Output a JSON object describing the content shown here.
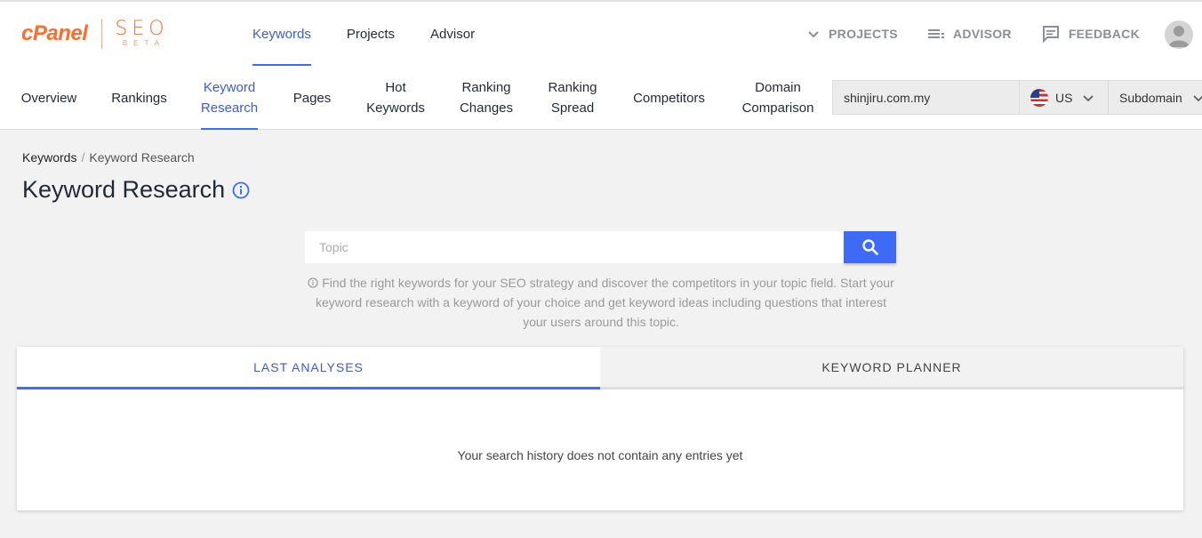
{
  "brand": {
    "name": "cPanel",
    "product": "SEO",
    "badge": "BETA",
    "accent": "#ff6c2c"
  },
  "main_nav": [
    {
      "label": "Keywords",
      "active": true
    },
    {
      "label": "Projects",
      "active": false
    },
    {
      "label": "Advisor",
      "active": false
    }
  ],
  "right_nav": {
    "projects": {
      "label": "PROJECTS",
      "icon": "chevron-down-icon"
    },
    "advisor": {
      "label": "ADVISOR",
      "icon": "list-icon"
    },
    "feedback": {
      "label": "FEEDBACK",
      "icon": "feedback-icon"
    }
  },
  "sub_nav": [
    {
      "label": "Overview"
    },
    {
      "label": "Rankings"
    },
    {
      "label": "Keyword Research",
      "active": true
    },
    {
      "label": "Pages"
    },
    {
      "label": "Hot Keywords"
    },
    {
      "label": "Ranking Changes"
    },
    {
      "label": "Ranking Spread"
    },
    {
      "label": "Competitors"
    },
    {
      "label": "Domain Comparison"
    }
  ],
  "domain_selector": {
    "domain": "shinjiru.com.my",
    "country": "US",
    "scope": "Subdomain"
  },
  "breadcrumb": {
    "root": "Keywords",
    "separator": "/",
    "current": "Keyword Research"
  },
  "page": {
    "title": "Keyword Research"
  },
  "search": {
    "placeholder": "Topic",
    "hint": "Find the right keywords for your SEO strategy and discover the competitors in your topic field. Start your keyword research with a keyword of your choice and get keyword ideas including questions that interest your users around this topic."
  },
  "results": {
    "tabs": [
      {
        "label": "LAST ANALYSES",
        "active": true
      },
      {
        "label": "KEYWORD PLANNER",
        "active": false
      }
    ],
    "empty_message": "Your search history does not contain any entries yet"
  },
  "colors": {
    "primary": "#3b6ef6",
    "brand": "#ff6c2c",
    "background": "#f2f2f2"
  }
}
